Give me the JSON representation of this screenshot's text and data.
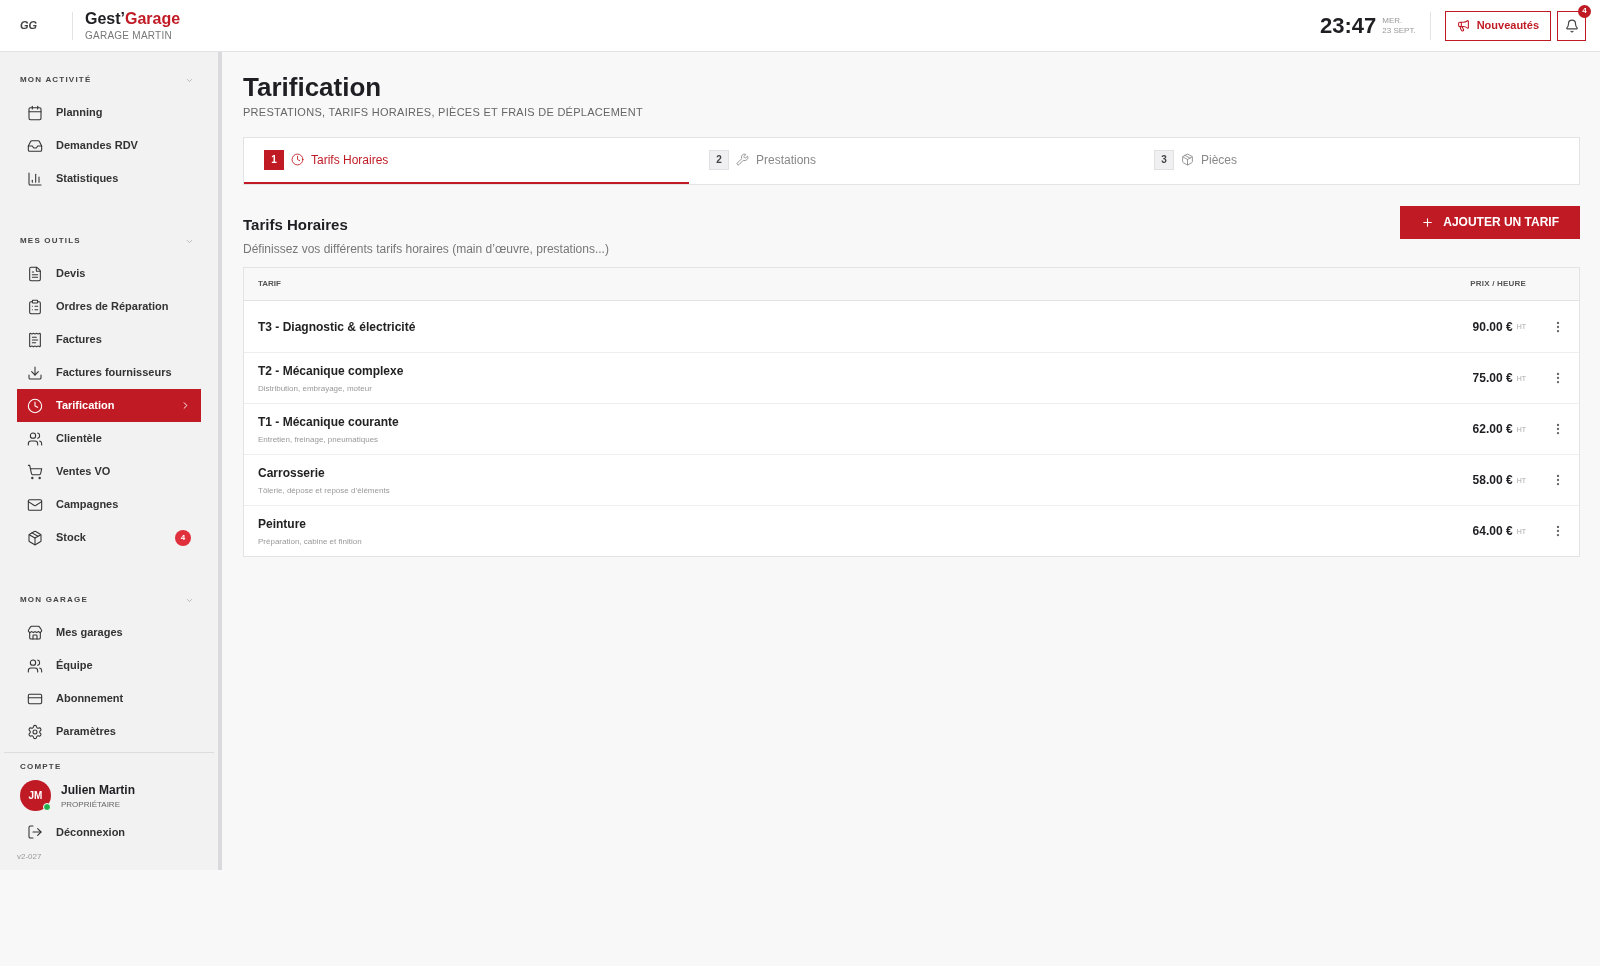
{
  "header": {
    "logo_text": "GG",
    "brand_plain": "Gest’",
    "brand_accent": "Garage",
    "garage": "GARAGE MARTIN",
    "time": "23:47",
    "day": "MER.",
    "date": "23 SEPT.",
    "news_button": "Nouveautés",
    "notifications": "4"
  },
  "sidebar": {
    "sections": [
      {
        "title": "MON ACTIVITÉ",
        "expanded": true,
        "items": [
          {
            "label": "Planning",
            "selected": false
          },
          {
            "label": "Demandes RDV",
            "selected": false
          },
          {
            "label": "Statistiques",
            "selected": false
          }
        ]
      },
      {
        "title": "MES OUTILS",
        "expanded": true,
        "items": [
          {
            "label": "Devis",
            "selected": false
          },
          {
            "label": "Ordres de Réparation",
            "selected": false
          },
          {
            "label": "Factures",
            "selected": false
          },
          {
            "label": "Factures fournisseurs",
            "selected": false
          },
          {
            "label": "Tarification",
            "selected": true
          },
          {
            "label": "Clientèle",
            "selected": false
          },
          {
            "label": "Ventes VO",
            "selected": false
          },
          {
            "label": "Campagnes",
            "selected": false
          },
          {
            "label": "Stock",
            "selected": false,
            "badge": "4"
          }
        ]
      },
      {
        "title": "MON GARAGE",
        "expanded": true,
        "items": [
          {
            "label": "Mes garages",
            "selected": false
          },
          {
            "label": "Équipe",
            "selected": false
          },
          {
            "label": "Abonnement",
            "selected": false
          },
          {
            "label": "Paramètres",
            "selected": false
          }
        ]
      }
    ],
    "account": {
      "title": "COMPTE",
      "initials": "JM",
      "name": "Julien Martin",
      "role": "PROPRIÉTAIRE",
      "online": true,
      "logout": "Déconnexion"
    },
    "version": "v2-027"
  },
  "page": {
    "title": "Tarification",
    "subtitle": "PRESTATIONS, TARIFS HORAIRES, PIÈCES ET FRAIS DE DÉPLACEMENT",
    "tabs": [
      {
        "number": "1",
        "label": "Tarifs Horaires",
        "selected": true
      },
      {
        "number": "2",
        "label": "Prestations",
        "selected": false
      },
      {
        "number": "3",
        "label": "Pièces",
        "selected": false
      }
    ],
    "section_title": "Tarifs Horaires",
    "section_description": "Définissez vos différents tarifs horaires (main d’œuvre, prestations...)",
    "add_button": "AJOUTER UN TARIF",
    "table": {
      "columns": [
        "TARIF",
        "PRIX / HEURE"
      ],
      "rows": [
        {
          "name": "T3 - Diagnostic & électricité",
          "price": "90.00 €",
          "unit": "HT"
        },
        {
          "name": "T2 - Mécanique complexe",
          "description": "Distribution, embrayage, moteur",
          "price": "75.00 €",
          "unit": "HT"
        },
        {
          "name": "T1 - Mécanique courante",
          "description": "Entretien, freinage, pneumatiques",
          "price": "62.00 €",
          "unit": "HT"
        },
        {
          "name": "Carrosserie",
          "description": "Tôlerie, dépose et repose d’éléments",
          "price": "58.00 €",
          "unit": "HT"
        },
        {
          "name": "Peinture",
          "description": "Préparation, cabine et finition",
          "price": "64.00 €",
          "unit": "HT"
        }
      ]
    }
  }
}
